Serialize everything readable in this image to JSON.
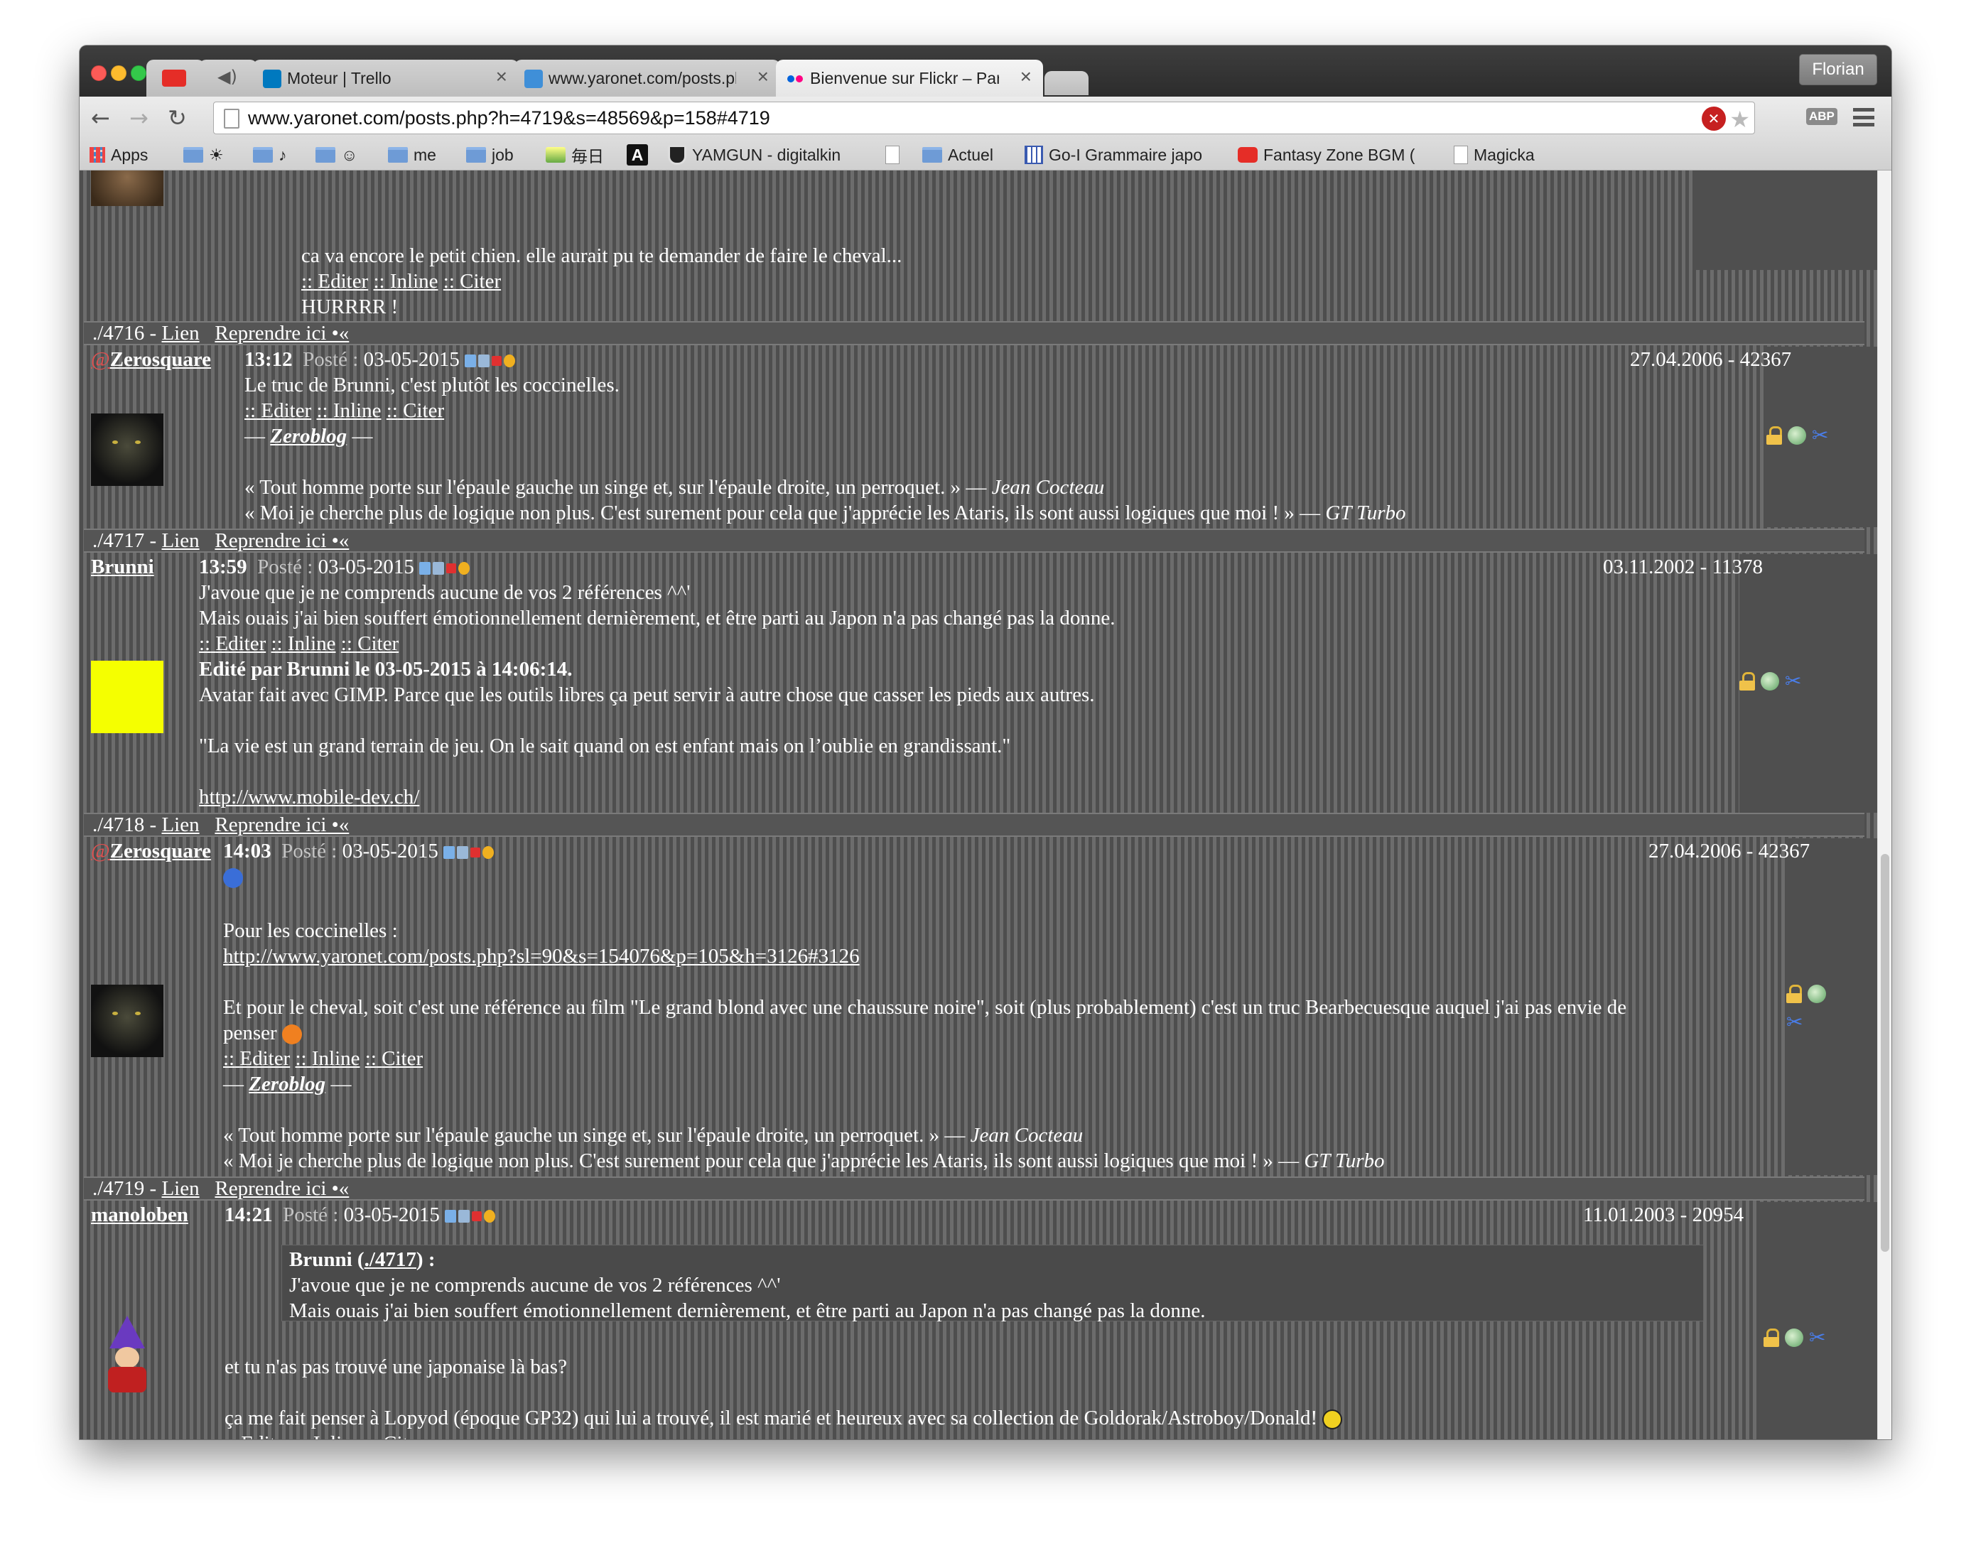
{
  "browser": {
    "tabs": [
      {
        "title": "",
        "icon": "youtube-icon"
      },
      {
        "title": "",
        "icon": "speaker-icon"
      },
      {
        "title": "Moteur | Trello",
        "icon": "trello-icon"
      },
      {
        "title": "www.yaronet.com/posts.ph",
        "icon": "yaronet-icon"
      },
      {
        "title": "Bienvenue sur Flickr – Part",
        "icon": "flickr-icon"
      }
    ],
    "user": "Florian",
    "url": "www.yaronet.com/posts.php?h=4719&s=48569&p=158#4719",
    "abp": "ABP",
    "bookmarks": [
      {
        "label": "Apps",
        "icon": "apps-grid-icon"
      },
      {
        "label": "☀",
        "icon": "folder-icon"
      },
      {
        "label": "♪",
        "icon": "folder-icon"
      },
      {
        "label": "☺",
        "icon": "folder-icon"
      },
      {
        "label": "me",
        "icon": "folder-icon"
      },
      {
        "label": "job",
        "icon": "folder-icon"
      },
      {
        "label": "毎日",
        "icon": "daily-icon"
      },
      {
        "label": "A",
        "icon": "a-icon"
      },
      {
        "label": "YAMGUN - digitalkin",
        "icon": "shield-icon"
      },
      {
        "label": "",
        "icon": "page-icon"
      },
      {
        "label": "Actuel",
        "icon": "folder-icon"
      },
      {
        "label": "Go-I Grammaire japo",
        "icon": "grid-icon"
      },
      {
        "label": "Fantasy Zone BGM (",
        "icon": "youtube-icon"
      },
      {
        "label": "Magicka",
        "icon": "page-icon"
      }
    ]
  },
  "common": {
    "link_sep": "::",
    "edit": "Editer",
    "inline": "Inline",
    "cite": "Citer",
    "lien": "Lien",
    "reprendre": "Reprendre ici •«",
    "poste": "Posté :",
    "date": "03-05-2015"
  },
  "post0": {
    "text": "ca va encore le petit chien. elle aurait pu te demander de faire le cheval...",
    "sig": "HURRRR !"
  },
  "bar1": {
    "num": "./4716 -"
  },
  "post1": {
    "author": "Zerosquare",
    "at": "@",
    "time": "13:12",
    "meta": "27.04.2006 - 42367",
    "text": "Le truc de Brunni, c'est plutôt les coccinelles.",
    "sig_dash": "—",
    "sig_link": "Zeroblog",
    "q1": "« Tout homme porte sur l'épaule gauche un singe et, sur l'épaule droite, un perroquet. » —",
    "q1_author": "Jean Cocteau",
    "q2": "« Moi je cherche plus de logique non plus. C'est surement pour cela que j'apprécie les Ataris, ils sont aussi logiques que moi ! » —",
    "q2_author": "GT Turbo"
  },
  "bar2": {
    "num": "./4717 -"
  },
  "post2": {
    "author": "Brunni",
    "time": "13:59",
    "meta": "03.11.2002 - 11378",
    "text1": "J'avoue que je ne comprends aucune de vos 2 références ^^'",
    "text2": "Mais ouais j'ai bien souffert émotionnellement dernièrement, et être parti au Japon n'a pas changé pas la donne.",
    "edited": "Edité par Brunni le 03-05-2015 à 14:06:14.",
    "sig1": "Avatar fait avec GIMP. Parce que les outils libres ça peut servir à autre chose que casser les pieds aux autres.",
    "sig2": "\"La vie est un grand terrain de jeu. On le sait quand on est enfant mais on l’oublie en grandissant.\"",
    "sig_url": "http://www.mobile-dev.ch/"
  },
  "bar3": {
    "num": "./4718 -"
  },
  "post3": {
    "author": "Zerosquare",
    "at": "@",
    "time": "14:03",
    "meta": "27.04.2006 - 42367",
    "text1": "Pour les coccinelles :",
    "url": "http://www.yaronet.com/posts.php?sl=90&s=154076&p=105&h=3126#3126",
    "text2": "Et pour le cheval, soit c'est une référence au film \"Le grand blond avec une chaussure noire\", soit (plus probablement) c'est un truc Bearbecuesque auquel j'ai pas envie de",
    "text3": "penser"
  },
  "bar4": {
    "num": "./4719 -"
  },
  "post4": {
    "author": "manoloben",
    "time": "14:21",
    "meta": "11.01.2003 - 20954",
    "quote_author": "Brunni",
    "quote_ref": "./4717",
    "quote_paren_open": "(",
    "quote_paren_close": ") :",
    "quote1": "J'avoue que je ne comprends aucune de vos 2 références ^^'",
    "quote2": "Mais ouais j'ai bien souffert émotionnellement dernièrement, et être parti au Japon n'a pas changé pas la donne.",
    "text1": "et tu n'as pas trouvé une japonaise là bas?",
    "text2": "ça me fait penser à Lopyod (époque GP32) qui lui a trouvé, il est marié et heureux avec sa collection de Goldorak/Astroboy/Donald!"
  },
  "colors": {
    "accent_at": "#e05050",
    "avatar_brunni": "#f5ff00",
    "text": "#ffffff",
    "background_stripe_dark": "#4e4e4e",
    "background_stripe_light": "#6c6c6c"
  }
}
